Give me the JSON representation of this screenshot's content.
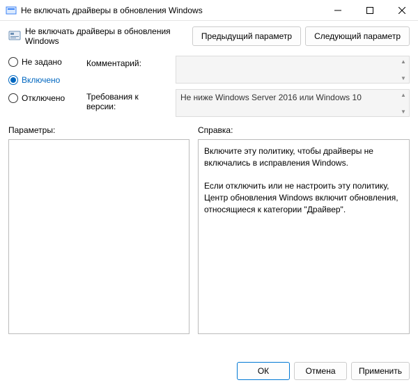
{
  "window": {
    "title": "Не включать драйверы в обновления Windows"
  },
  "header": {
    "title": "Не включать драйверы в обновления Windows",
    "prev_button": "Предыдущий параметр",
    "next_button": "Следующий параметр"
  },
  "state_options": {
    "not_configured": "Не задано",
    "enabled": "Включено",
    "disabled": "Отключено",
    "selected": "enabled"
  },
  "fields": {
    "comment_label": "Комментарий:",
    "comment_value": "",
    "supported_label": "Требования к версии:",
    "supported_value": "Не ниже Windows Server 2016 или Windows 10"
  },
  "panels": {
    "options_label": "Параметры:",
    "help_label": "Справка:",
    "help_text": "Включите эту политику, чтобы драйверы не включались в исправления Windows.\n\nЕсли отключить или не настроить эту политику, Центр обновления Windows включит обновления, относящиеся к категории \"Драйвер\"."
  },
  "footer": {
    "ok": "ОК",
    "cancel": "Отмена",
    "apply": "Применить"
  }
}
